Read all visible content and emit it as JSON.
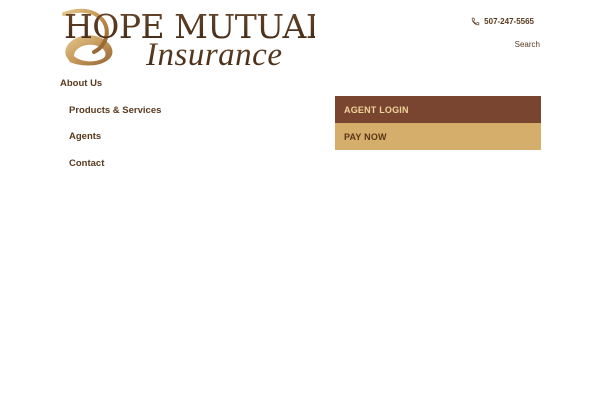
{
  "brand": {
    "line1": "HOPE MUTUAL",
    "line2": "Insurance",
    "colors": {
      "primary_brown": "#5a3a1e",
      "gold": "#c9a15e",
      "agent_login_bg": "#7a4530",
      "pay_now_bg": "#d4ae6a"
    }
  },
  "header": {
    "phone": "507-247-5565",
    "phone_icon": "phone-icon",
    "search_label": "Search"
  },
  "nav": {
    "items": [
      {
        "label": "About Us"
      },
      {
        "label": "Products & Services"
      },
      {
        "label": "Agents"
      },
      {
        "label": "Contact"
      }
    ]
  },
  "actions": {
    "agent_login": "AGENT LOGIN",
    "pay_now": "PAY NOW"
  }
}
